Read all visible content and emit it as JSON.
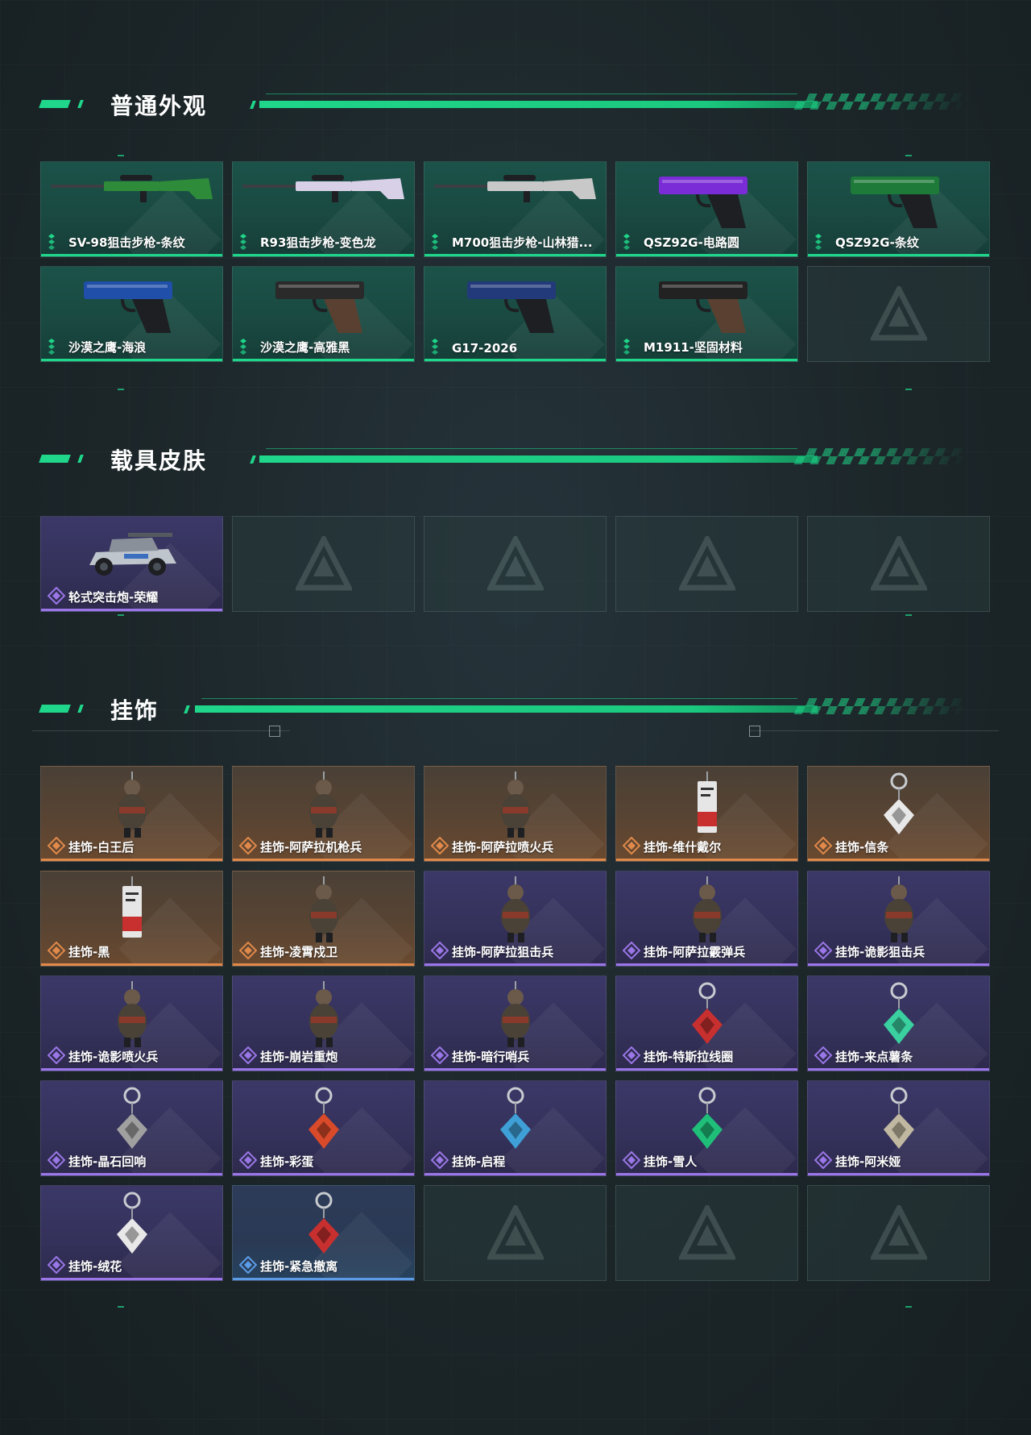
{
  "sections": {
    "appearance": {
      "title": "普通外观",
      "items": [
        {
          "label": "SV-98狙击步枪-条纹",
          "rarity": "green",
          "icon": "sniper-rifle-icon"
        },
        {
          "label": "R93狙击步枪-变色龙",
          "rarity": "green",
          "icon": "sniper-rifle-icon"
        },
        {
          "label": "M700狙击步枪-山林猎...",
          "rarity": "green",
          "icon": "sniper-rifle-icon"
        },
        {
          "label": "QSZ92G-电路圆",
          "rarity": "green",
          "icon": "pistol-icon"
        },
        {
          "label": "QSZ92G-条纹",
          "rarity": "green",
          "icon": "pistol-icon"
        },
        {
          "label": "沙漠之鹰-海浪",
          "rarity": "green",
          "icon": "pistol-icon"
        },
        {
          "label": "沙漠之鹰-高雅黑",
          "rarity": "green",
          "icon": "pistol-icon"
        },
        {
          "label": "G17-2026",
          "rarity": "green",
          "icon": "pistol-icon"
        },
        {
          "label": "M1911-坚固材料",
          "rarity": "green",
          "icon": "pistol-icon"
        },
        {
          "label": "",
          "rarity": "empty",
          "icon": "logo-icon"
        }
      ]
    },
    "vehicle": {
      "title": "载具皮肤",
      "items": [
        {
          "label": "轮式突击炮-荣耀",
          "rarity": "purple",
          "icon": "vehicle-icon"
        },
        {
          "label": "",
          "rarity": "empty",
          "icon": "logo-icon"
        },
        {
          "label": "",
          "rarity": "empty",
          "icon": "logo-icon"
        },
        {
          "label": "",
          "rarity": "empty",
          "icon": "logo-icon"
        },
        {
          "label": "",
          "rarity": "empty",
          "icon": "logo-icon"
        }
      ]
    },
    "charms": {
      "title": "挂饰",
      "items": [
        {
          "label": "挂饰-白王后",
          "rarity": "orange",
          "icon": "charm-figure-icon"
        },
        {
          "label": "挂饰-阿萨拉机枪兵",
          "rarity": "orange",
          "icon": "charm-figure-icon"
        },
        {
          "label": "挂饰-阿萨拉喷火兵",
          "rarity": "orange",
          "icon": "charm-figure-icon"
        },
        {
          "label": "挂饰-维什戴尔",
          "rarity": "orange",
          "icon": "charm-tag-icon"
        },
        {
          "label": "挂饰-信条",
          "rarity": "orange",
          "icon": "charm-keyring-icon"
        },
        {
          "label": "挂饰-黑",
          "rarity": "orange",
          "icon": "charm-tag-icon"
        },
        {
          "label": "挂饰-凌霄戍卫",
          "rarity": "orange",
          "icon": "charm-figure-icon"
        },
        {
          "label": "挂饰-阿萨拉狙击兵",
          "rarity": "purple",
          "icon": "charm-figure-icon"
        },
        {
          "label": "挂饰-阿萨拉霰弹兵",
          "rarity": "purple",
          "icon": "charm-figure-icon"
        },
        {
          "label": "挂饰-诡影狙击兵",
          "rarity": "purple",
          "icon": "charm-figure-icon"
        },
        {
          "label": "挂饰-诡影喷火兵",
          "rarity": "purple",
          "icon": "charm-figure-icon"
        },
        {
          "label": "挂饰-崩岩重炮",
          "rarity": "purple",
          "icon": "charm-figure-icon"
        },
        {
          "label": "挂饰-暗行哨兵",
          "rarity": "purple",
          "icon": "charm-figure-icon"
        },
        {
          "label": "挂饰-特斯拉线圈",
          "rarity": "purple",
          "icon": "charm-keyring-icon"
        },
        {
          "label": "挂饰-来点薯条",
          "rarity": "purple",
          "icon": "charm-keyring-icon"
        },
        {
          "label": "挂饰-晶石回响",
          "rarity": "purple",
          "icon": "charm-keyring-icon"
        },
        {
          "label": "挂饰-彩蛋",
          "rarity": "purple",
          "icon": "charm-keyring-icon"
        },
        {
          "label": "挂饰-启程",
          "rarity": "purple",
          "icon": "charm-keyring-icon"
        },
        {
          "label": "挂饰-雪人",
          "rarity": "purple",
          "icon": "charm-keyring-icon"
        },
        {
          "label": "挂饰-阿米娅",
          "rarity": "purple",
          "icon": "charm-keyring-icon"
        },
        {
          "label": "挂饰-绒花",
          "rarity": "purple",
          "icon": "charm-keyring-icon"
        },
        {
          "label": "挂饰-紧急撤离",
          "rarity": "blue",
          "icon": "charm-keyring-icon"
        },
        {
          "label": "",
          "rarity": "empty",
          "icon": "logo-icon"
        },
        {
          "label": "",
          "rarity": "empty",
          "icon": "logo-icon"
        },
        {
          "label": "",
          "rarity": "empty",
          "icon": "logo-icon"
        }
      ]
    }
  },
  "colors": {
    "accent_green": "#1fd68a",
    "rarity_green": "#1fd68a",
    "rarity_purple": "#9a76e6",
    "rarity_orange": "#e0894a",
    "rarity_blue": "#5c9ce6",
    "background": "#1c2629"
  }
}
